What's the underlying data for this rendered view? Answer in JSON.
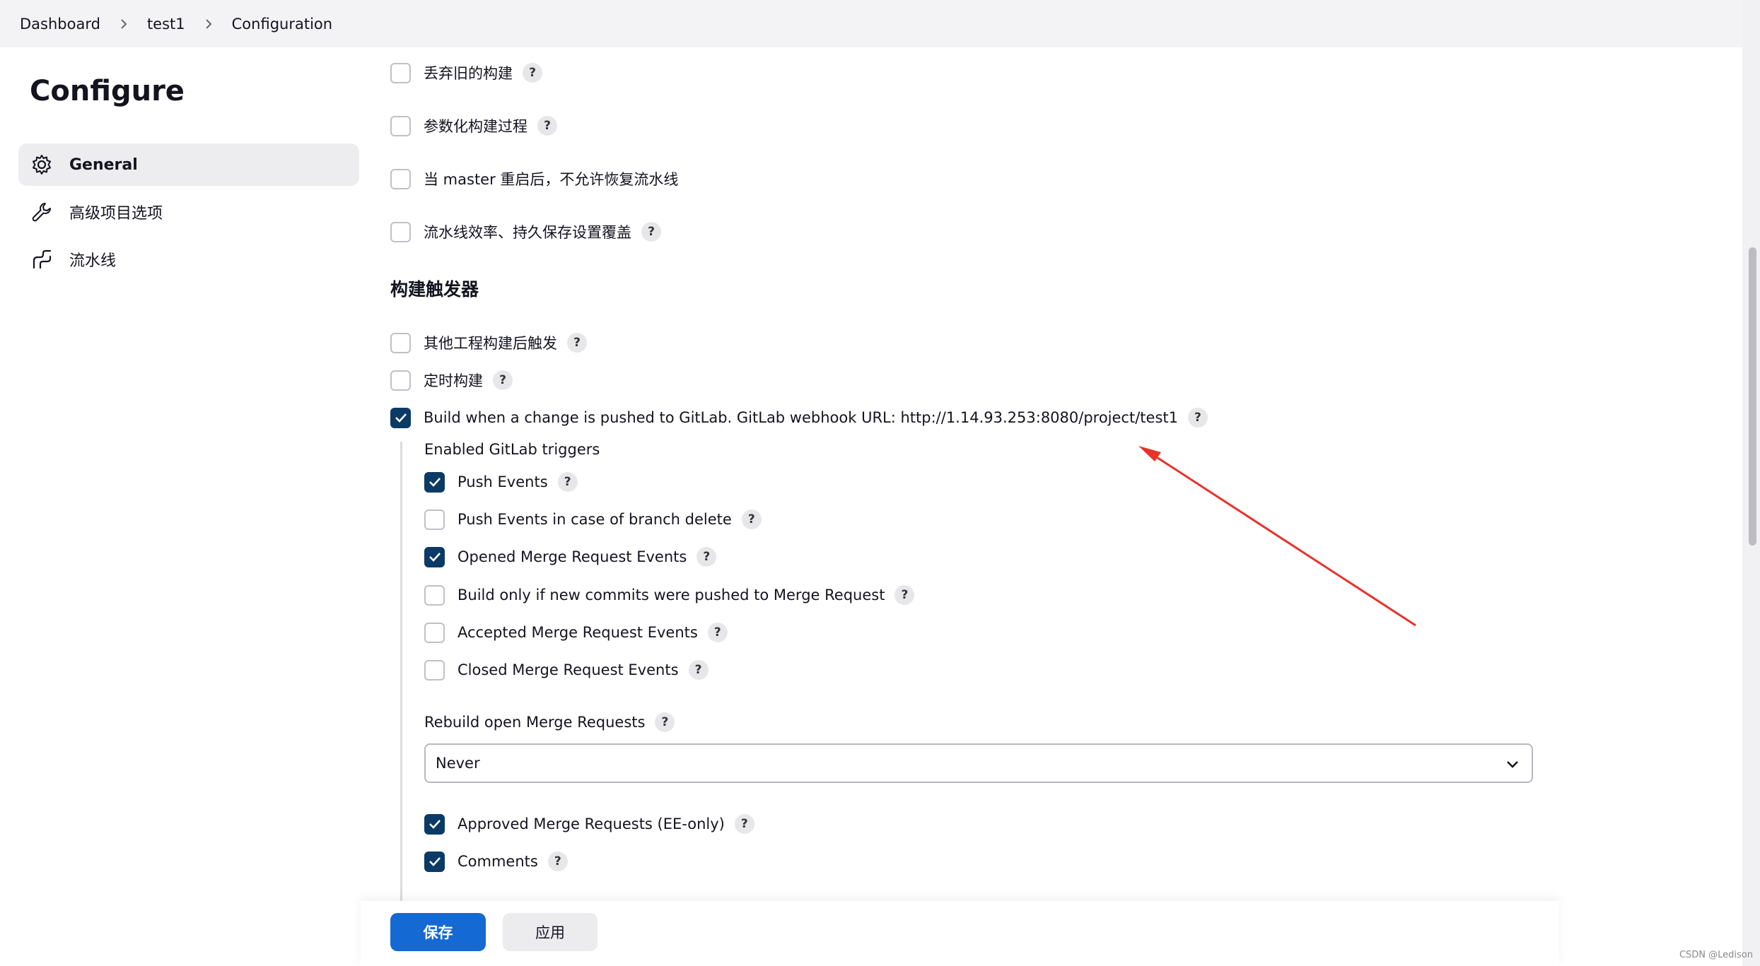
{
  "breadcrumb": [
    "Dashboard",
    "test1",
    "Configuration"
  ],
  "sidebar": {
    "title": "Configure",
    "items": [
      {
        "label": "General",
        "icon": "gear-icon",
        "active": true
      },
      {
        "label": "高级项目选项",
        "icon": "wrench-icon",
        "active": false
      },
      {
        "label": "流水线",
        "icon": "pipeline-icon",
        "active": false
      }
    ]
  },
  "general_options": [
    {
      "label": "丢弃旧的构建",
      "checked": false
    },
    {
      "label": "参数化构建过程",
      "checked": false
    },
    {
      "label": "当 master 重启后，不允许恢复流水线",
      "checked": false
    },
    {
      "label": "流水线效率、持久保存设置覆盖",
      "checked": false
    }
  ],
  "triggers": {
    "title": "构建触发器",
    "items": [
      {
        "label": "其他工程构建后触发",
        "checked": false
      },
      {
        "label": "定时构建",
        "checked": false
      },
      {
        "label": "Build when a change is pushed to GitLab. GitLab webhook URL: http://1.14.93.253:8080/project/test1",
        "checked": true
      }
    ]
  },
  "gitlab": {
    "enabled_label": "Enabled GitLab triggers",
    "events": [
      {
        "label": "Push Events",
        "checked": true
      },
      {
        "label": "Push Events in case of branch delete",
        "checked": false
      },
      {
        "label": "Opened Merge Request Events",
        "checked": true
      },
      {
        "label": "Build only if new commits were pushed to Merge Request",
        "checked": false
      },
      {
        "label": "Accepted Merge Request Events",
        "checked": false
      },
      {
        "label": "Closed Merge Request Events",
        "checked": false
      }
    ],
    "rebuild_label": "Rebuild open Merge Requests",
    "rebuild_value": "Never",
    "extra": [
      {
        "label": "Approved Merge Requests (EE-only)",
        "checked": true
      },
      {
        "label": "Comments",
        "checked": true
      }
    ]
  },
  "help_glyph": "?",
  "buttons": {
    "save": "保存",
    "apply": "应用"
  },
  "watermark": "CSDN @Ledison",
  "colors": {
    "accent": "#1469d3",
    "checkbox_checked": "#0b3a66",
    "arrow": "#e8322b"
  }
}
